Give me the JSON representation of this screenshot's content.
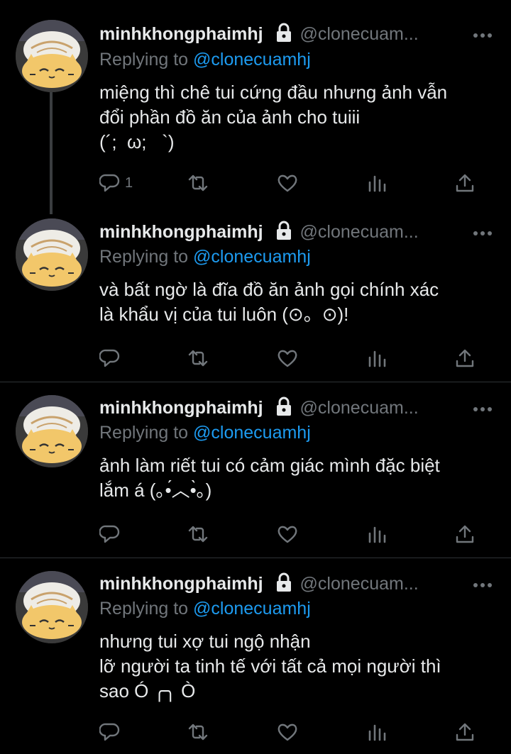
{
  "tweets": [
    {
      "name": "minhkhongphaimhj",
      "handle": "@clonecuam...",
      "replying_prefix": "Replying to",
      "replying_to": "@clonecuamhj",
      "text": "miệng thì chê tui cứng đầu nhưng ảnh vẫn\nđổi phần đồ ăn của ảnh cho tuiii\n(´;  ω;   `)",
      "reply_count": "1"
    },
    {
      "name": "minhkhongphaimhj",
      "handle": "@clonecuam...",
      "replying_prefix": "Replying to",
      "replying_to": "@clonecuamhj",
      "text": "và bất ngờ là đĩa đồ ăn ảnh gọi chính xác\nlà khẩu vị của tui luôn (⊙。⊙)!",
      "reply_count": ""
    },
    {
      "name": "minhkhongphaimhj",
      "handle": "@clonecuam...",
      "replying_prefix": "Replying to",
      "replying_to": "@clonecuamhj",
      "text": "ảnh làm riết tui có cảm giác mình đặc biệt\nlắm á (｡•́︿•̀｡)",
      "reply_count": ""
    },
    {
      "name": "minhkhongphaimhj",
      "handle": "@clonecuam...",
      "replying_prefix": "Replying to",
      "replying_to": "@clonecuamhj",
      "text": "nhưng tui xợ tui ngộ nhận\nlỡ người ta tinh tế với tất cả mọi người thì\nsao Ó ╭╮ Ò",
      "reply_count": ""
    }
  ],
  "colors": {
    "background": "#000000",
    "text": "#e7e9ea",
    "muted": "#71767b",
    "accent": "#1d9bf0",
    "divider": "#2f3336"
  },
  "icons": [
    "lock-icon",
    "more-icon",
    "reply-icon",
    "retweet-icon",
    "like-icon",
    "views-icon",
    "share-icon"
  ]
}
